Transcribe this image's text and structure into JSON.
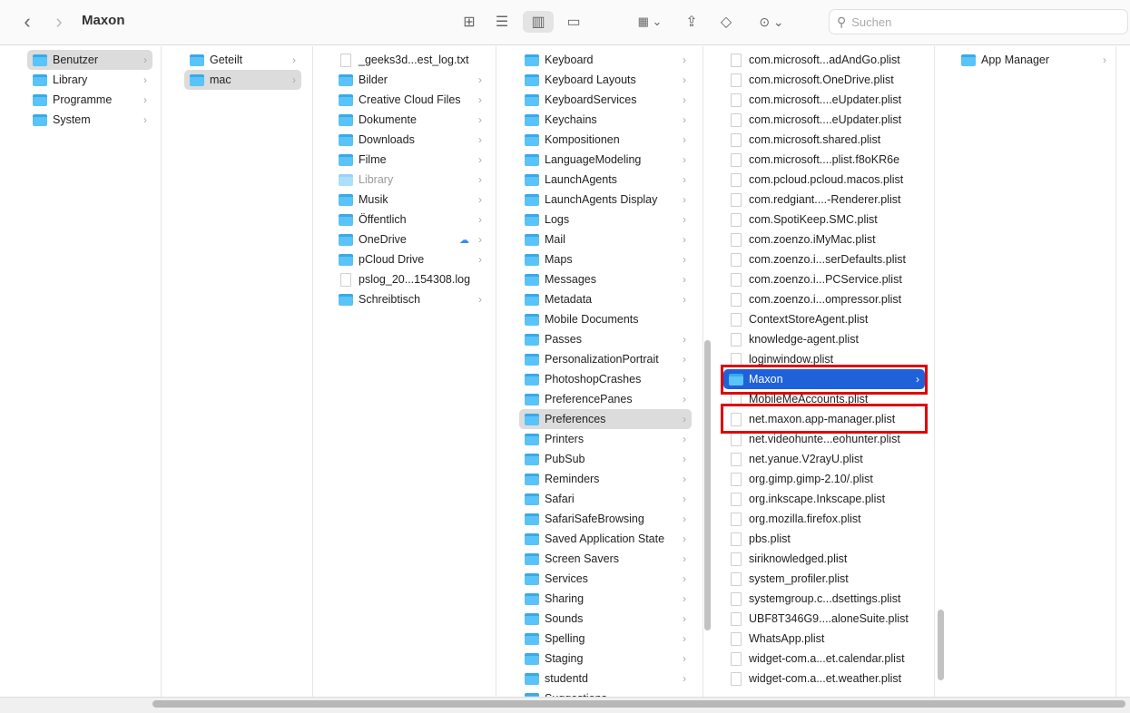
{
  "window": {
    "title": "Maxon"
  },
  "toolbar": {
    "back": "‹",
    "forward": "›",
    "search_placeholder": "Suchen"
  },
  "columns": [
    {
      "items": [
        {
          "label": "Benutzer",
          "type": "folder",
          "state": "sel",
          "chev": true
        },
        {
          "label": "Library",
          "type": "folder",
          "chev": true
        },
        {
          "label": "Programme",
          "type": "folder",
          "chev": true
        },
        {
          "label": "System",
          "type": "folder",
          "chev": true
        }
      ]
    },
    {
      "items": [
        {
          "label": "Geteilt",
          "type": "folder",
          "chev": true
        },
        {
          "label": "mac",
          "type": "folder",
          "state": "sel",
          "chev": true
        }
      ]
    },
    {
      "items": [
        {
          "label": "_geeks3d...est_log.txt",
          "type": "file"
        },
        {
          "label": "Bilder",
          "type": "folder",
          "chev": true
        },
        {
          "label": "Creative Cloud Files",
          "type": "folder",
          "chev": true
        },
        {
          "label": "Dokumente",
          "type": "folder",
          "chev": true
        },
        {
          "label": "Downloads",
          "type": "folder",
          "chev": true
        },
        {
          "label": "Filme",
          "type": "folder",
          "chev": true
        },
        {
          "label": "Library",
          "type": "folder",
          "state": "dim",
          "chev": true
        },
        {
          "label": "Musik",
          "type": "folder",
          "chev": true
        },
        {
          "label": "Öffentlich",
          "type": "folder",
          "chev": true
        },
        {
          "label": "OneDrive",
          "type": "folder",
          "chev": true,
          "cloud": true
        },
        {
          "label": "pCloud Drive",
          "type": "folder",
          "chev": true
        },
        {
          "label": "pslog_20...154308.log",
          "type": "file"
        },
        {
          "label": "Schreibtisch",
          "type": "folder",
          "chev": true
        }
      ]
    },
    {
      "items": [
        {
          "label": "Keyboard",
          "type": "folder",
          "chev": true
        },
        {
          "label": "Keyboard Layouts",
          "type": "folder",
          "chev": true
        },
        {
          "label": "KeyboardServices",
          "type": "folder",
          "chev": true
        },
        {
          "label": "Keychains",
          "type": "folder",
          "chev": true
        },
        {
          "label": "Kompositionen",
          "type": "folder",
          "chev": true
        },
        {
          "label": "LanguageModeling",
          "type": "folder",
          "chev": true
        },
        {
          "label": "LaunchAgents",
          "type": "folder",
          "chev": true
        },
        {
          "label": "LaunchAgents Display",
          "type": "folder",
          "chev": true
        },
        {
          "label": "Logs",
          "type": "folder",
          "chev": true
        },
        {
          "label": "Mail",
          "type": "folder",
          "chev": true
        },
        {
          "label": "Maps",
          "type": "folder",
          "chev": true
        },
        {
          "label": "Messages",
          "type": "folder",
          "chev": true
        },
        {
          "label": "Metadata",
          "type": "folder",
          "chev": true
        },
        {
          "label": "Mobile Documents",
          "type": "folder"
        },
        {
          "label": "Passes",
          "type": "folder",
          "chev": true
        },
        {
          "label": "PersonalizationPortrait",
          "type": "folder",
          "chev": true
        },
        {
          "label": "PhotoshopCrashes",
          "type": "folder",
          "chev": true
        },
        {
          "label": "PreferencePanes",
          "type": "folder",
          "chev": true
        },
        {
          "label": "Preferences",
          "type": "folder",
          "state": "sel",
          "chev": true
        },
        {
          "label": "Printers",
          "type": "folder",
          "chev": true
        },
        {
          "label": "PubSub",
          "type": "folder",
          "chev": true
        },
        {
          "label": "Reminders",
          "type": "folder",
          "chev": true
        },
        {
          "label": "Safari",
          "type": "folder",
          "chev": true
        },
        {
          "label": "SafariSafeBrowsing",
          "type": "folder",
          "chev": true
        },
        {
          "label": "Saved Application State",
          "type": "folder",
          "chev": true
        },
        {
          "label": "Screen Savers",
          "type": "folder",
          "chev": true
        },
        {
          "label": "Services",
          "type": "folder",
          "chev": true
        },
        {
          "label": "Sharing",
          "type": "folder",
          "chev": true
        },
        {
          "label": "Sounds",
          "type": "folder",
          "chev": true
        },
        {
          "label": "Spelling",
          "type": "folder",
          "chev": true
        },
        {
          "label": "Staging",
          "type": "folder",
          "chev": true
        },
        {
          "label": "studentd",
          "type": "folder",
          "chev": true
        },
        {
          "label": "Suggestions",
          "type": "folder",
          "chev": true
        }
      ]
    },
    {
      "items": [
        {
          "label": "com.microsoft...adAndGo.plist",
          "type": "file"
        },
        {
          "label": "com.microsoft.OneDrive.plist",
          "type": "file"
        },
        {
          "label": "com.microsoft....eUpdater.plist",
          "type": "file"
        },
        {
          "label": "com.microsoft....eUpdater.plist",
          "type": "file"
        },
        {
          "label": "com.microsoft.shared.plist",
          "type": "file"
        },
        {
          "label": "com.microsoft....plist.f8oKR6e",
          "type": "file"
        },
        {
          "label": "com.pcloud.pcloud.macos.plist",
          "type": "file"
        },
        {
          "label": "com.redgiant....-Renderer.plist",
          "type": "file"
        },
        {
          "label": "com.SpotiKeep.SMC.plist",
          "type": "file"
        },
        {
          "label": "com.zoenzo.iMyMac.plist",
          "type": "file"
        },
        {
          "label": "com.zoenzo.i...serDefaults.plist",
          "type": "file"
        },
        {
          "label": "com.zoenzo.i...PCService.plist",
          "type": "file"
        },
        {
          "label": "com.zoenzo.i...ompressor.plist",
          "type": "file"
        },
        {
          "label": "ContextStoreAgent.plist",
          "type": "file"
        },
        {
          "label": "knowledge-agent.plist",
          "type": "file"
        },
        {
          "label": "loginwindow.plist",
          "type": "file"
        },
        {
          "label": "Maxon",
          "type": "folder",
          "state": "active",
          "chev": true
        },
        {
          "label": "MobileMeAccounts.plist",
          "type": "file"
        },
        {
          "label": "net.maxon.app-manager.plist",
          "type": "file"
        },
        {
          "label": "net.videohunte...eohunter.plist",
          "type": "file"
        },
        {
          "label": "net.yanue.V2rayU.plist",
          "type": "file"
        },
        {
          "label": "org.gimp.gimp-2.10/.plist",
          "type": "file"
        },
        {
          "label": "org.inkscape.Inkscape.plist",
          "type": "file"
        },
        {
          "label": "org.mozilla.firefox.plist",
          "type": "file"
        },
        {
          "label": "pbs.plist",
          "type": "file"
        },
        {
          "label": "siriknowledged.plist",
          "type": "file"
        },
        {
          "label": "system_profiler.plist",
          "type": "file"
        },
        {
          "label": "systemgroup.c...dsettings.plist",
          "type": "file"
        },
        {
          "label": "UBF8T346G9....aloneSuite.plist",
          "type": "file"
        },
        {
          "label": "WhatsApp.plist",
          "type": "file"
        },
        {
          "label": "widget-com.a...et.calendar.plist",
          "type": "file"
        },
        {
          "label": "widget-com.a...et.weather.plist",
          "type": "file"
        }
      ]
    },
    {
      "items": [
        {
          "label": "App Manager",
          "type": "folder",
          "chev": true
        }
      ]
    }
  ],
  "colors": {
    "selection": "#1f61d9",
    "highlight_box": "#e00000",
    "folder": "#5ac3f7"
  }
}
